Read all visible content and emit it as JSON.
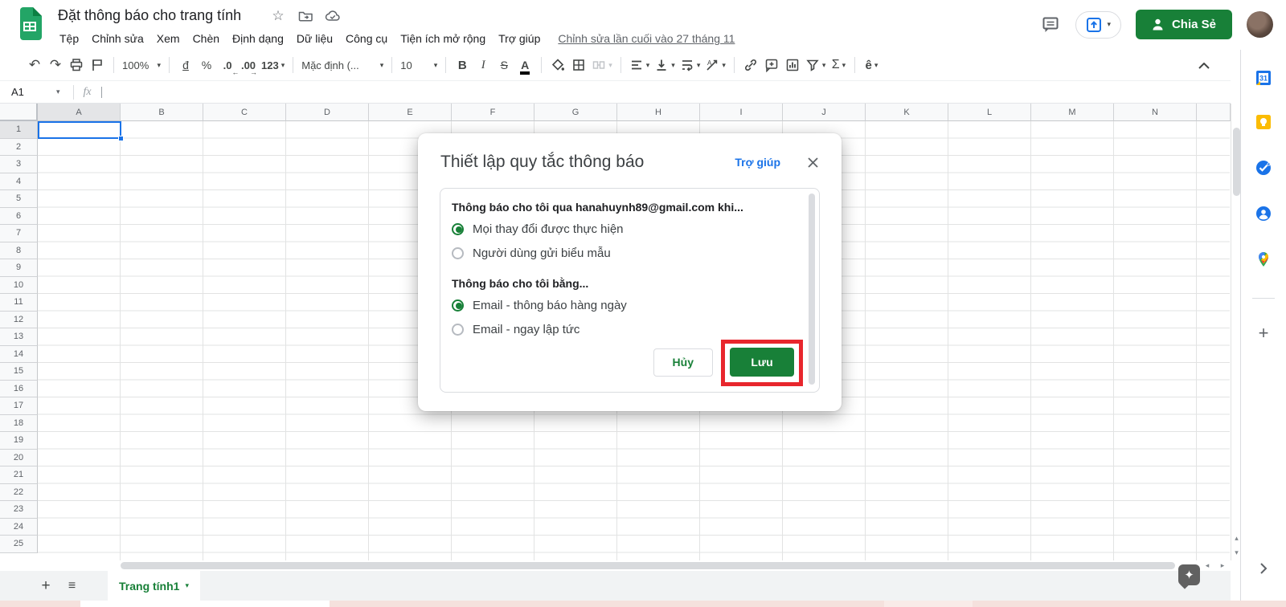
{
  "titlebar": {
    "title": "Đặt thông báo cho trang tính"
  },
  "menubar": {
    "items": [
      "Tệp",
      "Chỉnh sửa",
      "Xem",
      "Chèn",
      "Định dạng",
      "Dữ liệu",
      "Công cụ",
      "Tiện ích mở rộng",
      "Trợ giúp"
    ],
    "last_edit": "Chỉnh sửa lần cuối vào 27 tháng 11"
  },
  "header_actions": {
    "share_label": "Chia Sẻ"
  },
  "toolbar": {
    "zoom": "100%",
    "currency": "đ",
    "percent": "%",
    "decrease_decimal": ".0",
    "increase_decimal": ".00",
    "more_formats": "123",
    "font_name": "Mặc định (...",
    "font_size": "10",
    "bold": "B",
    "italic": "I",
    "strikethrough": "S",
    "text_color": "A",
    "sum": "Σ",
    "input_tools": "ê"
  },
  "formula_bar": {
    "cell_ref": "A1",
    "fx_label": "fx"
  },
  "grid": {
    "columns": [
      "A",
      "B",
      "C",
      "D",
      "E",
      "F",
      "G",
      "H",
      "I",
      "J",
      "K",
      "L",
      "M",
      "N"
    ],
    "row_count": 25,
    "selected_cell": "A1"
  },
  "dialog": {
    "title": "Thiết lập quy tắc thông báo",
    "help_label": "Trợ giúp",
    "groups": [
      {
        "heading": "Thông báo cho tôi qua hanahuynh89@gmail.com khi...",
        "options": [
          {
            "label": "Mọi thay đổi được thực hiện",
            "selected": true
          },
          {
            "label": "Người dùng gửi biểu mẫu",
            "selected": false
          }
        ]
      },
      {
        "heading": "Thông báo cho tôi bằng...",
        "options": [
          {
            "label": "Email - thông báo hàng ngày",
            "selected": true
          },
          {
            "label": "Email - ngay lập tức",
            "selected": false
          }
        ]
      }
    ],
    "cancel_label": "Hủy",
    "save_label": "Lưu"
  },
  "sheet_tabs": {
    "active_tab": "Trang tính1"
  },
  "colors": {
    "brand_green": "#188038",
    "link_blue": "#1a73e8",
    "annotation_red": "#e8262d",
    "selection_blue": "#1a73e8"
  }
}
